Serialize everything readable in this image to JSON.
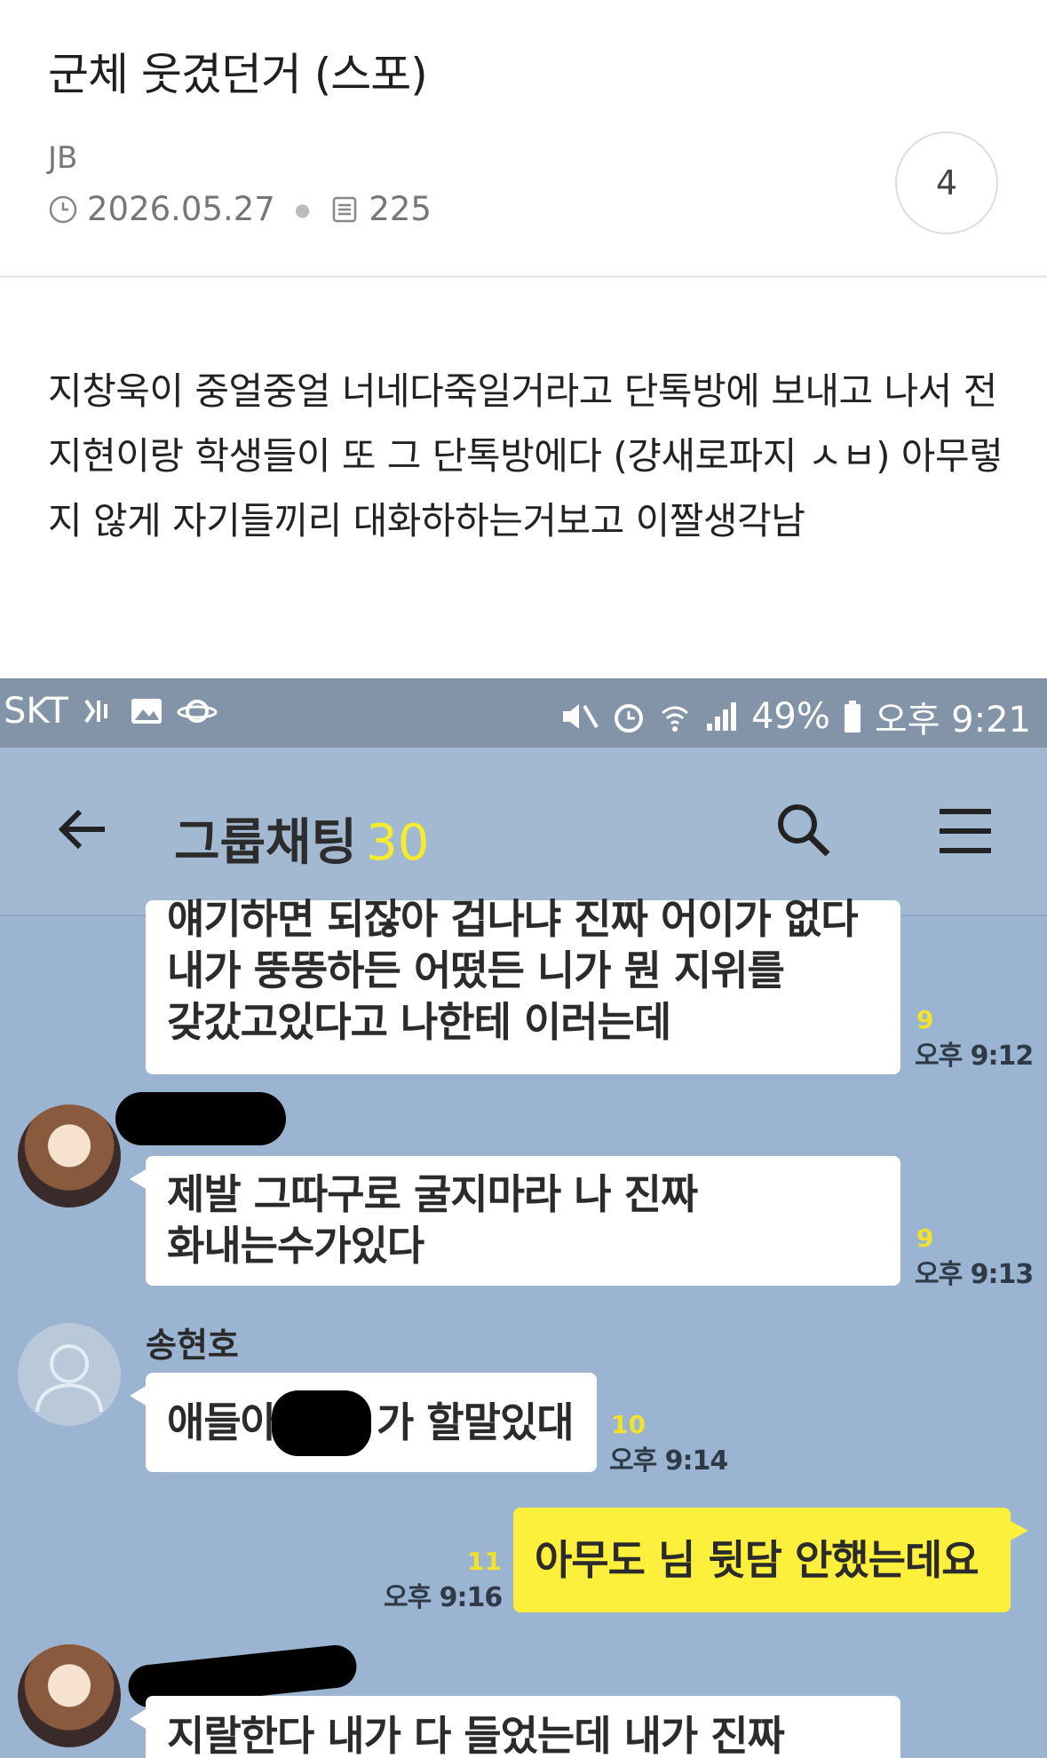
{
  "post": {
    "title": "군체 웃겼던거 (스포)",
    "author": "JB",
    "date": "2026.05.27",
    "views": "225",
    "comments": "4",
    "body": "지창욱이 중얼중얼 너네다죽일거라고 단톡방에 보내고 나서 전지현이랑 학생들이 또 그 단톡방에다 (걍새로파지 ㅅㅂ) 아무렇지 않게 자기들끼리 대화하하는거보고 이짤생각남"
  },
  "screenshot": {
    "status": {
      "carrier": "SKT",
      "battery": "49%",
      "clock": "오후 9:21"
    },
    "chat": {
      "title": "그룹채팅",
      "member_count": "30"
    },
    "messages": [
      {
        "lines": [
          "얘기하면 되잖아 겁나냐 진짜 어이가 없다",
          "내가 뚱뚱하든 어떴든 니가 뭔 지위를",
          "갖갔고있다고 나한테 이러는데"
        ],
        "unread": "9",
        "time": "오후 9:12"
      },
      {
        "lines": [
          "제발 그따구로 굴지마라 나 진짜",
          "화내는수가있다"
        ],
        "unread": "9",
        "time": "오후 9:13"
      },
      {
        "sender": "송현호",
        "lines": [
          "애들아",
          "가 할말있대"
        ],
        "unread": "10",
        "time": "오후 9:14"
      },
      {
        "lines": [
          "아무도 님 뒷담 안했는데요"
        ],
        "unread": "11",
        "time": "오후 9:16"
      },
      {
        "lines": [
          "지랄한다 내가 다 들었는데 내가 진짜"
        ]
      }
    ],
    "icons": {
      "back": "arrow-left-icon",
      "search": "search-icon",
      "menu": "hamburger-menu-icon"
    }
  }
}
